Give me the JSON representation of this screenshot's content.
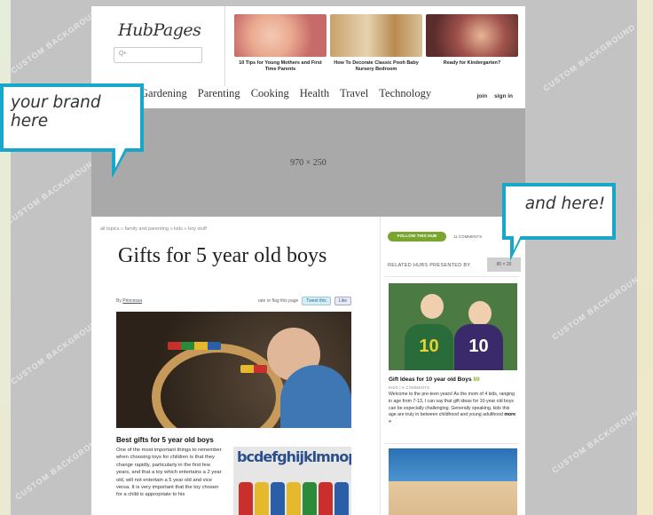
{
  "header": {
    "logo": "HubPages",
    "search_placeholder": "Q•",
    "promos": [
      {
        "caption": "10 Tips for Young Mothers and First Time Parents"
      },
      {
        "caption": "How To Decorate Classic Pooh Baby Nursery Bedroom"
      },
      {
        "caption": "Ready for Kindergarten?"
      }
    ]
  },
  "nav": {
    "items": [
      "Gardening",
      "Parenting",
      "Cooking",
      "Health",
      "Travel",
      "Technology"
    ],
    "join": "join",
    "signin": "sign in"
  },
  "banner": {
    "size_label": "970 × 250"
  },
  "watermark": "CUSTOM BACKGROUND",
  "article": {
    "breadcrumb": "all topics » family and parenting » kids » boy stuff",
    "title": "Gifts for 5 year old boys",
    "by_label": "By",
    "author": "Princessa",
    "rate_label": "rate or flag this page",
    "tweet_label": "Tweet this",
    "like_label": "Like",
    "section_heading": "Best gifts for 5 year old boys",
    "body": "One of the most important things to remember when choosing toys for children is that they change rapidly, particularly in the first few years, and that a toy which entertains a 2 year old, will not entertain a 5 year old and vice versa. It is very important that the toy chosen for a child is appropriate to his",
    "lego_text": "bcdefghijklmnop"
  },
  "sidebar": {
    "follow_label": "FOLLOW THIS HUB",
    "comments_label": "11 COMMENTS",
    "related_label": "RELATED HUBS PRESENTED BY",
    "related_ad": "80 × 20",
    "hub1": {
      "title": "Gift Ideas for 10 year old Boys",
      "score": "89",
      "meta": "KIDS | 8 COMMENTS",
      "text": "Welcome to the pre-teen years! As the mom of 4 kids, ranging in age from 7-13, I can say that gift ideas for 10-year old boys can be especially challenging. Generally speaking, kids this age are truly in between childhood and young adulthood",
      "more": "more »",
      "jersey_number": "10"
    }
  },
  "callouts": {
    "brand": "your brand here",
    "and_here": "and here!"
  },
  "colors": {
    "callout_border": "#19a7c9",
    "follow_green": "#7aa630",
    "background_grey": "#c3c3c3"
  }
}
